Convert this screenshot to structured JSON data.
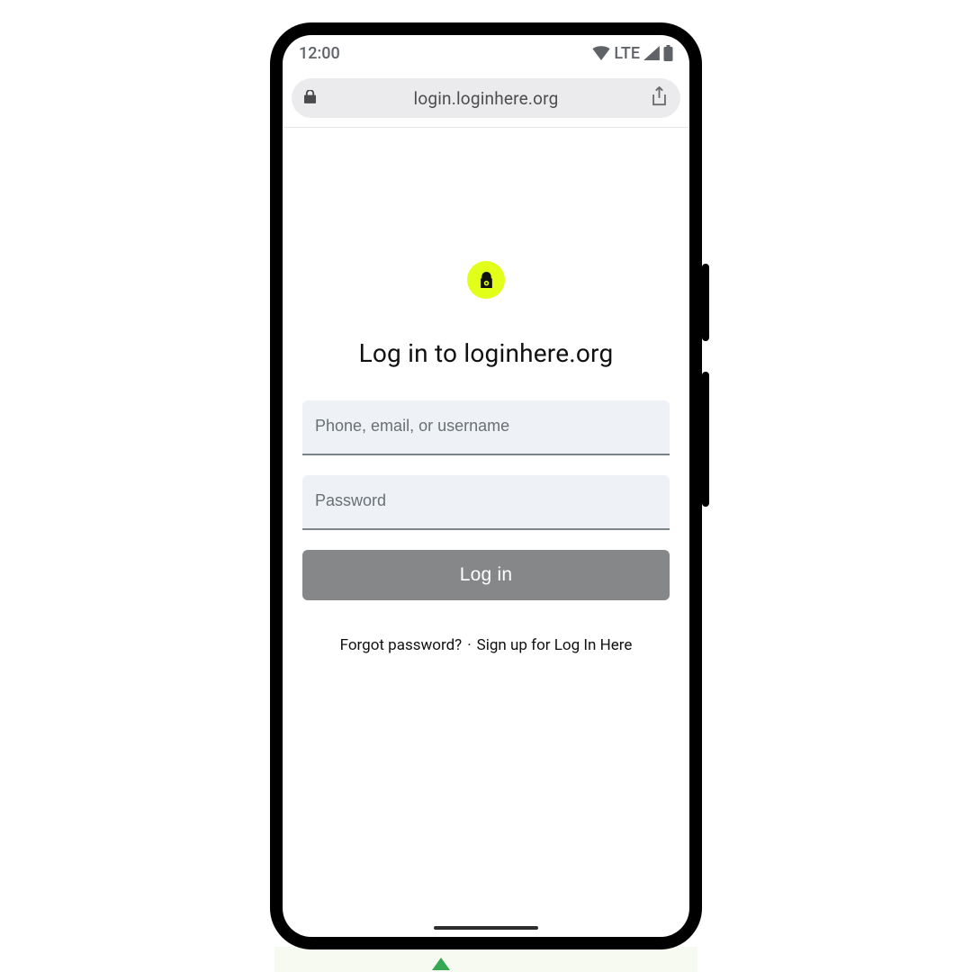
{
  "status": {
    "time": "12:00",
    "network_label": "LTE"
  },
  "browser": {
    "url": "login.loginhere.org"
  },
  "login": {
    "heading": "Log in to loginhere.org",
    "username_placeholder": "Phone, email, or username",
    "password_placeholder": "Password",
    "button_label": "Log in",
    "forgot_label": "Forgot password?",
    "separator": "·",
    "signup_label": "Sign up for Log In Here"
  },
  "colors": {
    "logo_bg": "#e2ff1a",
    "button_bg": "#868789",
    "field_bg": "#eef1f5"
  }
}
